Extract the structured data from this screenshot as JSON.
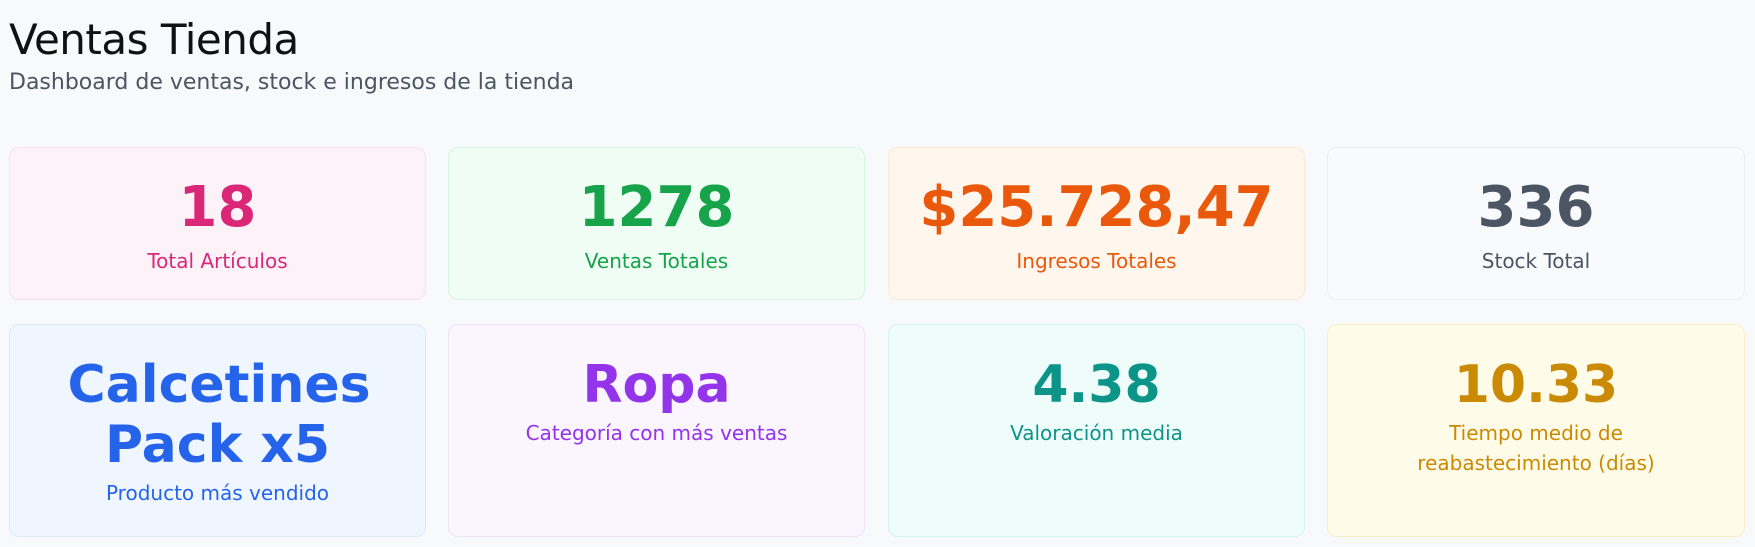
{
  "header": {
    "title": "Ventas Tienda",
    "subtitle": "Dashboard de ventas, stock e ingresos de la tienda"
  },
  "metrics": [
    {
      "value": "18",
      "label": "Total Artículos",
      "color": "#db2777"
    },
    {
      "value": "1278",
      "label": "Ventas Totales",
      "color": "#16a34a"
    },
    {
      "value": "$25.728,47",
      "label": "Ingresos Totales",
      "color": "#ea580c"
    },
    {
      "value": "336",
      "label": "Stock Total",
      "color": "#4b5563"
    },
    {
      "value": "Calcetines Pack x5",
      "label": "Producto más vendido",
      "color": "#2563eb"
    },
    {
      "value": "Ropa",
      "label": "Categoría con más ventas",
      "color": "#9333ea"
    },
    {
      "value": "4.38",
      "label": "Valoración media",
      "color": "#0d9488"
    },
    {
      "value": "10.33",
      "label": "Tiempo medio de reabastecimiento (días)",
      "color": "#ca8a04"
    }
  ]
}
